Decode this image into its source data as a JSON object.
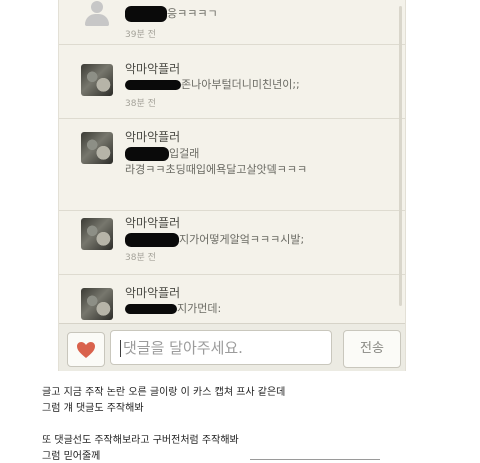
{
  "comments": [
    {
      "name": "",
      "text": "응ㅋㅋㅋㄱ",
      "time": "39분 전",
      "avatar": "default-user"
    },
    {
      "name": "악마악플러",
      "text": "존나아부털더니미친년이;;",
      "time": "38분 전",
      "avatar": "photo"
    },
    {
      "name": "악마악플러",
      "text_line1": "입걸래",
      "text_line2": "라경ㅋㅋ초딩때입에욕달고살앗뎈ㅋㅋㅋ",
      "time": "",
      "avatar": "photo"
    },
    {
      "name": "악마악플러",
      "text": "지가어떻게알엌ㅋㅋㅋ시발;",
      "time": "38분 전",
      "avatar": "photo"
    },
    {
      "name": "악마악플러",
      "text": "지가먼데:",
      "time": "",
      "avatar": "photo"
    }
  ],
  "input": {
    "placeholder": "댓글을 달아주세요.",
    "send_label": "전송",
    "like_icon": "heart-icon"
  },
  "post": {
    "lines": [
      "글고 지금 주작 논란 오른 글이랑 이 카스 캡쳐 프사 같은데",
      "그럼 걔 댓글도 주작해봐",
      "또 댓글선도 주작해보라고 구버전처럼 주작해봐",
      "그럼 믿어줄께"
    ]
  },
  "colors": {
    "heart": "#d9624c",
    "panel_bg": "#f4f2ea"
  }
}
